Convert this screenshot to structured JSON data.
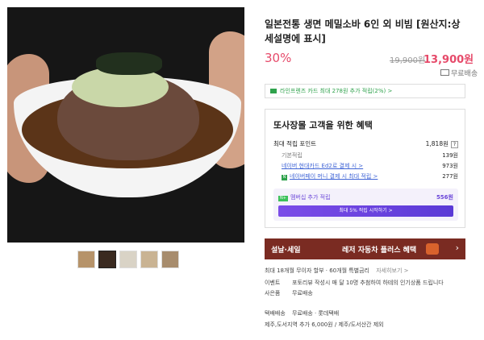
{
  "product": {
    "title": "일본전통 생면 메밀소바 6인 외 비빔 [원산지:상세설명에 표시]",
    "discount": "30%",
    "original_price": "19,900원",
    "price": "13,900원",
    "shipping": "무료배송"
  },
  "card_bar": {
    "label": "라인프렌즈 카드 최대 278원 추가 적립(2%) >"
  },
  "benefit": {
    "heading": "또사장몰 고객을 위한 혜택",
    "max_points_label": "최대 적립 포인트",
    "max_points_value": "1,818원",
    "help": "?",
    "rows": [
      {
        "label": "기본적립",
        "value": "139원"
      },
      {
        "label": "네이버 현대카드 Ed2로 결제 시 >",
        "value": "973원"
      },
      {
        "label": "네이버페이 머니 결제 시 최대 적립 >",
        "value": "277원"
      }
    ],
    "member_label": "멤버십 추가 적립",
    "member_badge": "N+",
    "member_value": "556원",
    "member_button": "최대 5% 적립 시작하기 >"
  },
  "promo": {
    "left": "설날·세일",
    "right": "레저 자동차 플러스 혜택",
    "chevron": "›"
  },
  "info": {
    "installment": "최대 18개월 무이자 할부 · 60개월 특별금리",
    "installment_link": "자세히보기 >",
    "event_label": "이벤트",
    "event_text": "포토리뷰 작성시 매 달 10명 추첨하여 하테의 인기상품 드립니다",
    "gift_label": "사은품",
    "gift_text": "무료배송",
    "delivery_label": "택배배송",
    "delivery_text": "무료배송 · 롯데택배",
    "delivery_extra": "제주,도서지역 추가 6,000원 / 제주/도서산간 제외"
  }
}
